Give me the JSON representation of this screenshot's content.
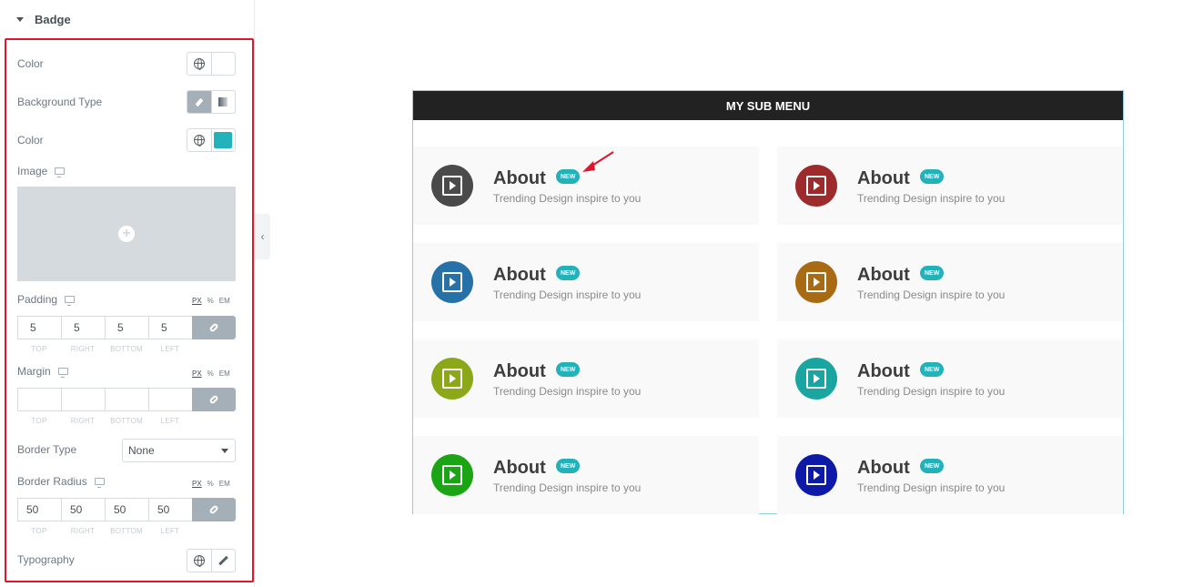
{
  "panel": {
    "section_title": "Badge",
    "color_label": "Color",
    "background_type_label": "Background Type",
    "bg_color_label": "Color",
    "bg_color_value": "#23b1ba",
    "image_label": "Image",
    "padding_label": "Padding",
    "margin_label": "Margin",
    "border_type_label": "Border Type",
    "border_type_value": "None",
    "border_radius_label": "Border Radius",
    "typography_label": "Typography",
    "units": [
      "PX",
      "%",
      "EM"
    ],
    "dim_labels": [
      "TOP",
      "RIGHT",
      "BOTTOM",
      "LEFT"
    ],
    "padding_values": [
      "5",
      "5",
      "5",
      "5"
    ],
    "margin_values": [
      "",
      "",
      "",
      ""
    ],
    "radius_values": [
      "50",
      "50",
      "50",
      "50"
    ],
    "accent_color": "#e2162a"
  },
  "preview": {
    "header": "MY SUB MENU",
    "items": [
      {
        "title": "About",
        "badge": "NEW",
        "subtitle": "Trending Design inspire to you",
        "color": "#4a4a4a"
      },
      {
        "title": "About",
        "badge": "NEW",
        "subtitle": "Trending Design inspire to you",
        "color": "#9e2b2b"
      },
      {
        "title": "About",
        "badge": "NEW",
        "subtitle": "Trending Design inspire to you",
        "color": "#2672a8"
      },
      {
        "title": "About",
        "badge": "NEW",
        "subtitle": "Trending Design inspire to you",
        "color": "#a86a12"
      },
      {
        "title": "About",
        "badge": "NEW",
        "subtitle": "Trending Design inspire to you",
        "color": "#8aa817"
      },
      {
        "title": "About",
        "badge": "NEW",
        "subtitle": "Trending Design inspire to you",
        "color": "#1aa5a0"
      },
      {
        "title": "About",
        "badge": "NEW",
        "subtitle": "Trending Design inspire to you",
        "color": "#1ba514"
      },
      {
        "title": "About",
        "badge": "NEW",
        "subtitle": "Trending Design inspire to you",
        "color": "#0d1aa8"
      }
    ]
  }
}
